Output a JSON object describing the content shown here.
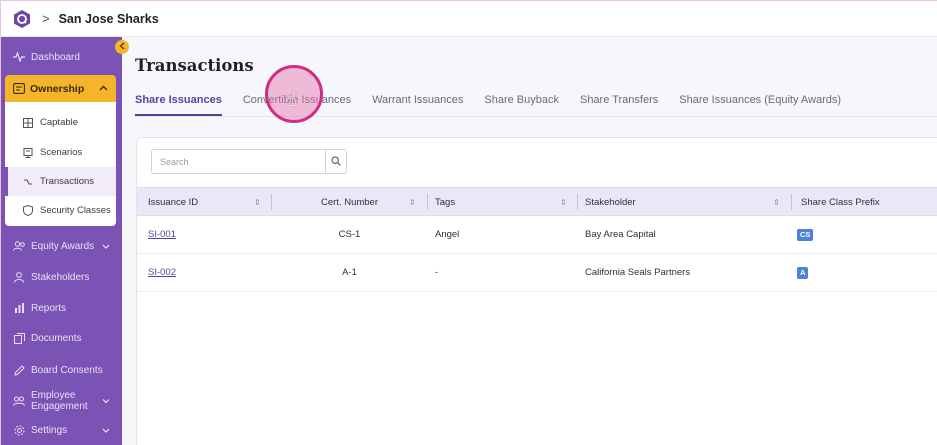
{
  "header": {
    "breadcrumb_sep": ">",
    "org_name": "San Jose Sharks"
  },
  "sidebar": {
    "collapse_icon": "chevron-left-icon",
    "items": [
      {
        "label": "Dashboard",
        "icon": "pulse-icon"
      },
      {
        "label": "Ownership",
        "icon": "ownership-icon"
      },
      {
        "label": "Equity Awards",
        "icon": "users-icon"
      },
      {
        "label": "Stakeholders",
        "icon": "person-icon"
      },
      {
        "label": "Reports",
        "icon": "bar-chart-icon"
      },
      {
        "label": "Documents",
        "icon": "documents-icon"
      },
      {
        "label": "Board Consents",
        "icon": "pen-icon"
      },
      {
        "label": "Employee Engagement",
        "icon": "engagement-icon"
      },
      {
        "label": "Settings",
        "icon": "gear-icon"
      }
    ],
    "ownership_submenu": [
      {
        "label": "Captable",
        "icon": "grid-icon"
      },
      {
        "label": "Scenarios",
        "icon": "scenario-icon"
      },
      {
        "label": "Transactions",
        "icon": "transactions-icon",
        "active": true
      },
      {
        "label": "Security Classes",
        "icon": "shield-icon"
      }
    ],
    "accent_color": "#7b53b4",
    "ownership_color": "#f5b52a"
  },
  "main": {
    "title": "Transactions",
    "tabs": [
      {
        "label": "Share Issuances",
        "active": true
      },
      {
        "label": "Convertible Issuances"
      },
      {
        "label": "Warrant Issuances"
      },
      {
        "label": "Share Buyback"
      },
      {
        "label": "Share Transfers"
      },
      {
        "label": "Share Issuances (Equity Awards)"
      }
    ],
    "search": {
      "placeholder": "Search"
    },
    "table": {
      "columns": [
        "Issuance ID",
        "Cert. Number",
        "Tags",
        "Stakeholder",
        "Share Class Prefix"
      ],
      "rows": [
        {
          "issuance_id": "SI-001",
          "cert_number": "CS-1",
          "tags": "Angel",
          "stakeholder": "Bay Area Capital",
          "prefix": "CS"
        },
        {
          "issuance_id": "SI-002",
          "cert_number": "A-1",
          "tags": "-",
          "stakeholder": "California Seals Partners",
          "prefix": "A"
        }
      ]
    }
  }
}
